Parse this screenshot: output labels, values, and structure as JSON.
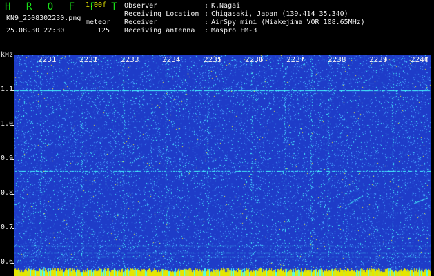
{
  "header": {
    "app_title": "HROFFT",
    "gain": "1.00f",
    "filename": "KN9_2508302230.png",
    "datetime": "25.08.30 22:30",
    "mode_label": "meteor",
    "count": "125"
  },
  "meta": [
    {
      "key": "Observer",
      "value": "K.Nagai"
    },
    {
      "key": "Receiving Location",
      "value": "Chigasaki, Japan (139.414 35.340)"
    },
    {
      "key": "Receiver",
      "value": "AirSpy mini (Miakejima VOR 108.65MHz)"
    },
    {
      "key": "Receiving antenna",
      "value": "Maspro FM-3"
    }
  ],
  "spectrogram": {
    "y_unit": "kHz",
    "y_range": [
      0.58,
      1.15
    ],
    "y_ticks": [
      "1.1",
      "1.0",
      "0.9",
      "0.8",
      "0.7",
      "0.6"
    ],
    "time_labels": [
      "2231",
      "2232",
      "2233",
      "2234",
      "2235",
      "2236",
      "2237",
      "2238",
      "2239",
      "2240"
    ],
    "colors": {
      "background": "#1e3cc8",
      "noise": "#46a0ff",
      "signal": "#46ffff",
      "strong": "#ffff32",
      "bottom_strip": "#e6e600"
    }
  }
}
